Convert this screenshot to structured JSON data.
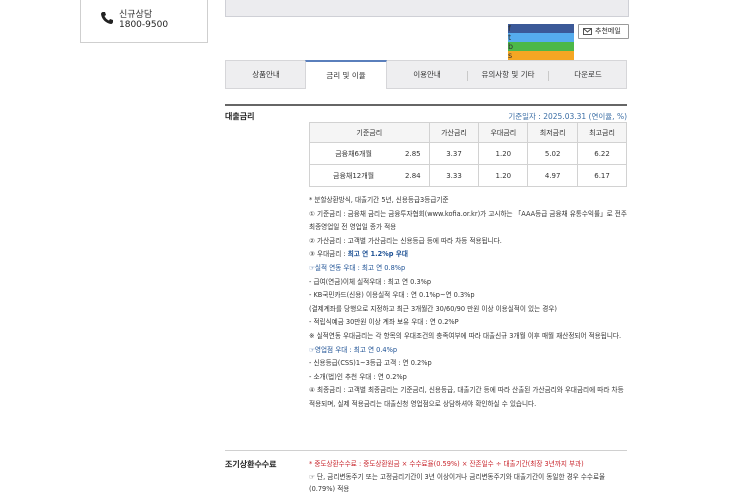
{
  "consult": {
    "label": "신규상담",
    "number": "1800-9500",
    "icon": "phone-icon"
  },
  "share": {
    "buttons": [
      {
        "name": "facebook-icon",
        "glyph": "f",
        "color": "#3b5998"
      },
      {
        "name": "twitter-icon",
        "glyph": "t",
        "color": "#55acee"
      },
      {
        "name": "band-icon",
        "glyph": "b",
        "color": "#4cb848"
      },
      {
        "name": "kakaostory-icon",
        "glyph": "s",
        "color": "#f5a623"
      }
    ],
    "recommend_label": "추천메일"
  },
  "tabs": [
    {
      "label": "상품안내",
      "active": false
    },
    {
      "label": "금리 및 이율",
      "active": true
    },
    {
      "label": "이용안내",
      "active": false
    },
    {
      "label": "유의사항 및 기타",
      "active": false
    },
    {
      "label": "다운로드",
      "active": false
    }
  ],
  "loan_rate": {
    "title": "대출금리",
    "base_date": "기준일자 : 2025.03.31 (연이율, %)",
    "headers": [
      "기준금리",
      "가산금리",
      "우대금리",
      "최저금리",
      "최고금리"
    ],
    "rows": [
      {
        "name": "금융채6개월",
        "base": "2.85",
        "add": "3.37",
        "pref": "1.20",
        "min": "5.02",
        "max": "6.22"
      },
      {
        "name": "금융채12개월",
        "base": "2.84",
        "add": "3.33",
        "pref": "1.20",
        "min": "4.97",
        "max": "6.17"
      }
    ],
    "notes": {
      "n1": "*  분할상환방식, 대출기간 5년, 신용등급3등급기준",
      "n2": "① 기준금리 : 금융채 금리는 금융투자협회(www.kofia.or.kr)가 고시하는 「AAA등급 금융채 유통수익률」로 전주 최종영업일 전 영업일 종가 적용",
      "n3": "② 가산금리 : 고객별 가산금리는 신용등급 등에 따라 차등 적용됩니다.",
      "n4_prefix": "③ 우대금리 : ",
      "n4_bold": "최고 연 1.2%p 우대",
      "n5": "☞실적 연동 우대 : 최고 연 0.8%p",
      "n6": "- 급여(연금)이체 실적우대 : 최고 연 0.3%p",
      "n7": "- KB국민카드(신용) 이용실적 우대 : 연 0.1%p~연 0.3%p",
      "n8": "(결제계좌를 당행으로 지정하고 최근 3개월간 30/60/90 만원 이상 이용실적이 있는 경우)",
      "n9": "- 적립식예금 30만원 이상 계좌 보유 우대 : 연 0.2%P",
      "n10": "※ 실적연동 우대금리는 각 항목의 우대조건의 충족여부에 따라 대출신규 3개월 이후 매월 재산정되어 적용됩니다.",
      "n11": "☞영업점 우대 : 최고 연 0.4%p",
      "n12": "- 신용등급(CSS)1~3등급 고객 : 연 0.2%p",
      "n13": "- 소개(법)인 추천 우대 : 연 0.2%p",
      "n14": "④ 최종금리 : 고객별 최종금리는 기준금리, 신용등급, 대출기간 등에 따라 산출된 가산금리와 우대금리에 따라 차등 적용되며, 실제 적용금리는 대출신청 영업점으로 상담하셔야 확인하실 수 있습니다."
    }
  },
  "early_repayment": {
    "title": "조기상환수수료",
    "n1": "*  중도상환수수료 : 중도상환원금 × 수수료율(0.59%) × 잔존일수 ÷ 대출기간(최장 3년까지 부과)",
    "n2": "☞ 단, 금리변동주기 또는 고정금리기간이 3년 이상이거나 금리변동주기와 대출기간이 동일한 경우 수수료율(0.79%) 적용"
  }
}
